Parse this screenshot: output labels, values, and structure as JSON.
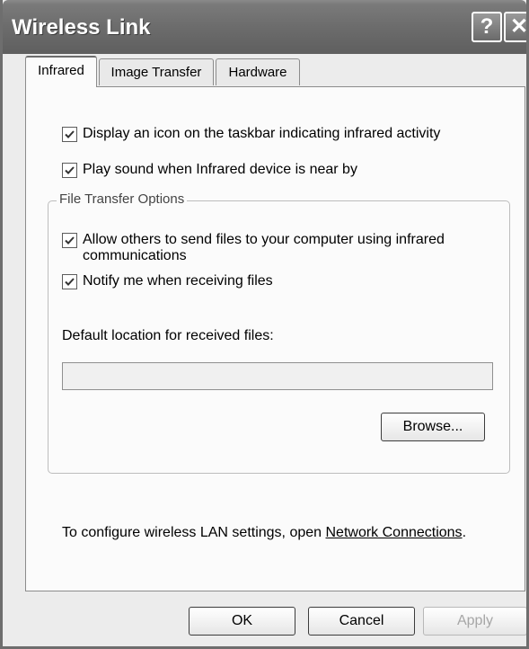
{
  "window": {
    "title": "Wireless Link"
  },
  "titlebar": {
    "help_glyph": "?",
    "close_glyph": "✕"
  },
  "tabs": [
    {
      "label": "Infrared",
      "active": true
    },
    {
      "label": "Image Transfer",
      "active": false
    },
    {
      "label": "Hardware",
      "active": false
    }
  ],
  "infrared": {
    "checkboxes": [
      {
        "label": "Display an icon on the taskbar indicating infrared activity",
        "checked": true
      },
      {
        "label": "Play sound when Infrared device is near by",
        "checked": true
      }
    ],
    "file_transfer": {
      "group_label": "File Transfer Options",
      "checkboxes": [
        {
          "label": "Allow others to send files to your computer using infrared communications",
          "checked": true
        },
        {
          "label": "Notify me when receiving files",
          "checked": true
        }
      ],
      "location_label": "Default location for received files:",
      "location_value": "",
      "browse_label": "Browse..."
    },
    "lan_text": "To configure wireless LAN settings, open ",
    "lan_link": "Network Connections",
    "lan_suffix": "."
  },
  "footer": {
    "ok_label": "OK",
    "cancel_label": "Cancel",
    "apply_label": "Apply"
  }
}
